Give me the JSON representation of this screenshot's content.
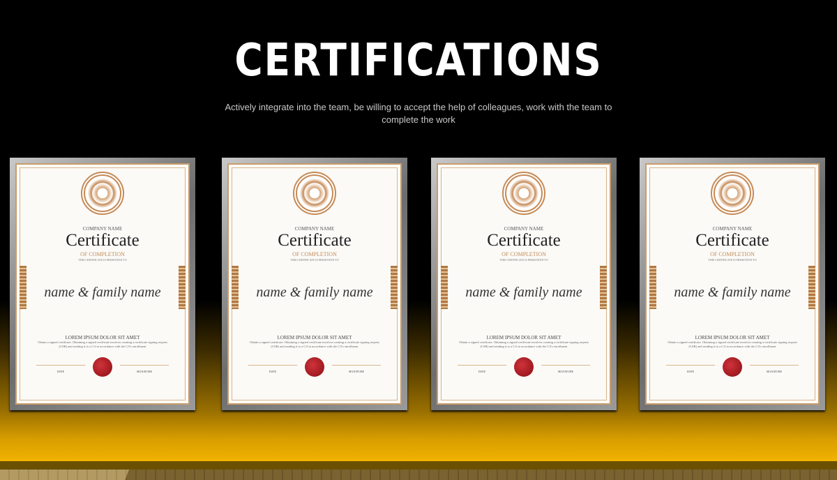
{
  "header": {
    "title": "CERTIFICATIONS",
    "subtitle": "Actively integrate into the team, be willing to accept the help of colleagues, work with the team to complete the work"
  },
  "certificates": [
    {
      "company": "COMPANY NAME",
      "title": "Certificate",
      "subtitle": "OF COMPLETION",
      "presented": "THIS CERTIFICATE IS PRESENTED TO",
      "name": "name & family name",
      "heading": "LOREM IPSUM DOLOR SIT AMET",
      "body": "Obtain a signed certificate. Obtaining a signed certificate involves creating a certificate signing request (CSR) and sending it to a CA in accordance with the CA's enrollment",
      "date": "DATE",
      "signature": "SIGNATURE"
    },
    {
      "company": "COMPANY NAME",
      "title": "Certificate",
      "subtitle": "OF COMPLETION",
      "presented": "THIS CERTIFICATE IS PRESENTED TO",
      "name": "name & family name",
      "heading": "LOREM IPSUM DOLOR SIT AMET",
      "body": "Obtain a signed certificate. Obtaining a signed certificate involves creating a certificate signing request (CSR) and sending it to a CA in accordance with the CA's enrollment",
      "date": "DATE",
      "signature": "SIGNATURE"
    },
    {
      "company": "COMPANY NAME",
      "title": "Certificate",
      "subtitle": "OF COMPLETION",
      "presented": "THIS CERTIFICATE IS PRESENTED TO",
      "name": "name & family name",
      "heading": "LOREM IPSUM DOLOR SIT AMET",
      "body": "Obtain a signed certificate. Obtaining a signed certificate involves creating a certificate signing request (CSR) and sending it to a CA in accordance with the CA's enrollment",
      "date": "DATE",
      "signature": "SIGNATURE"
    },
    {
      "company": "COMPANY NAME",
      "title": "Certificate",
      "subtitle": "OF COMPLETION",
      "presented": "THIS CERTIFICATE IS PRESENTED TO",
      "name": "name & family name",
      "heading": "LOREM IPSUM DOLOR SIT AMET",
      "body": "Obtain a signed certificate. Obtaining a signed certificate involves creating a certificate signing request (CSR) and sending it to a CA in accordance with the CA's enrollment",
      "date": "DATE",
      "signature": "SIGNATURE"
    }
  ]
}
